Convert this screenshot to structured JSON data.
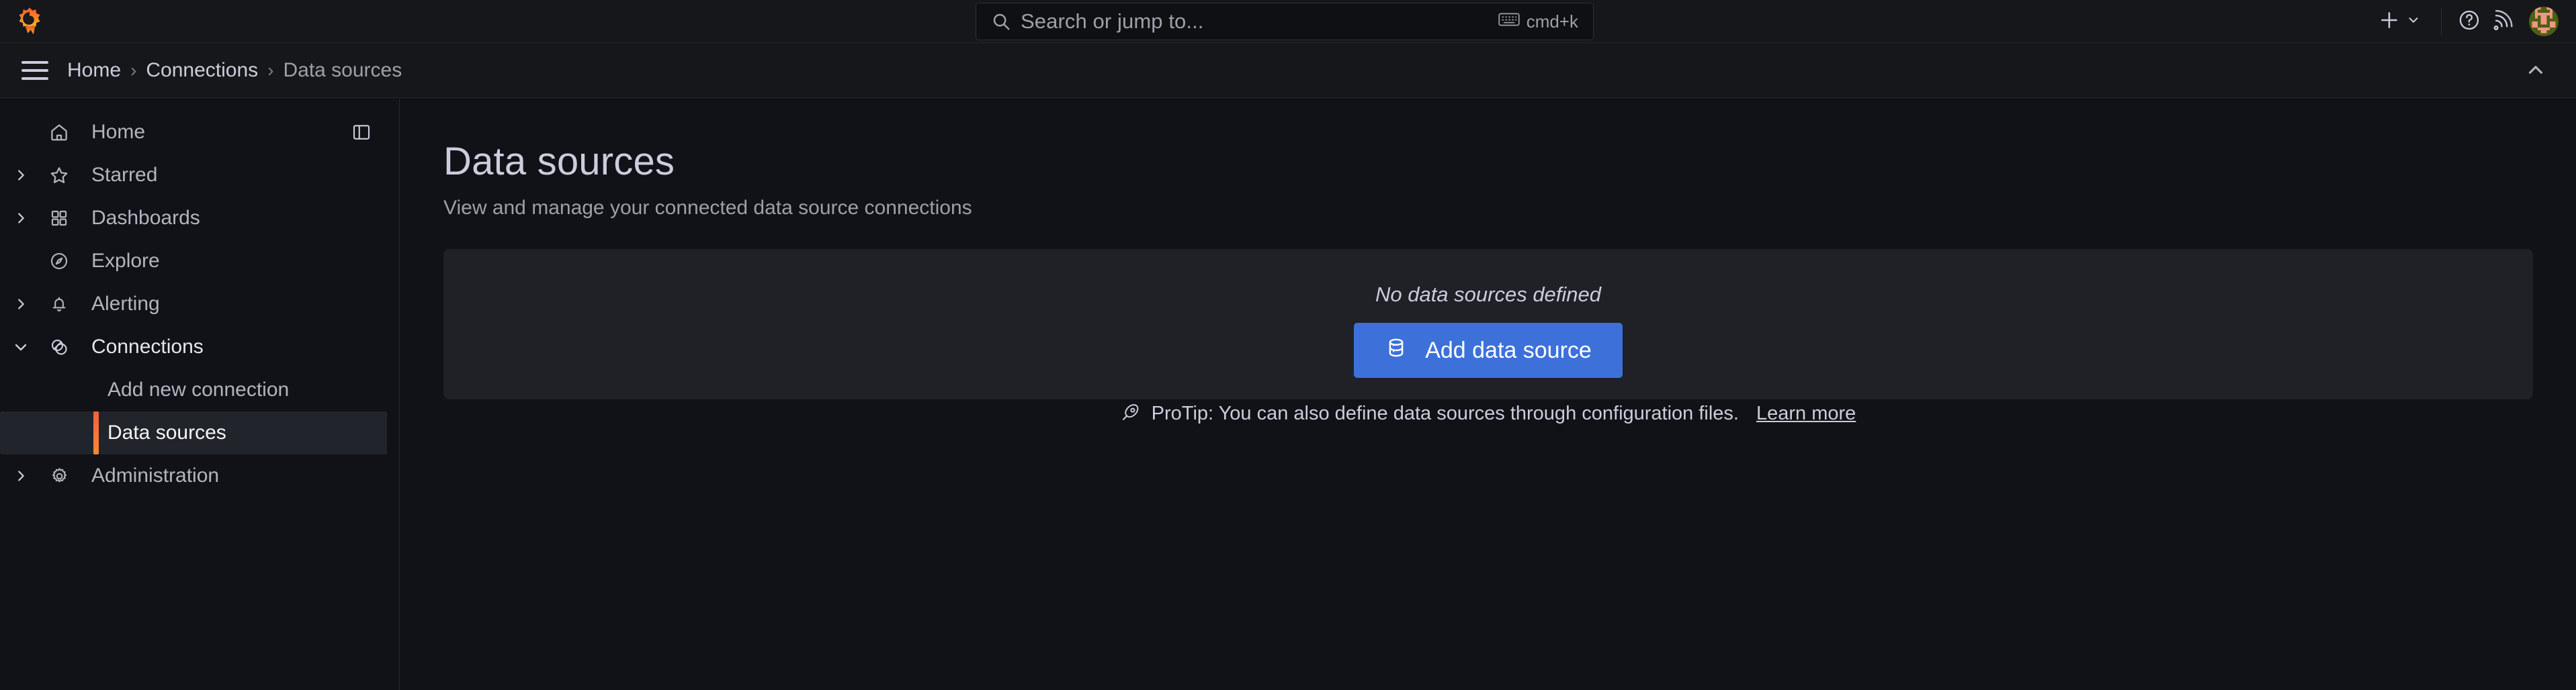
{
  "topbar": {
    "logo_icon": "grafana-logo-icon",
    "search": {
      "placeholder": "Search or jump to...",
      "value": "",
      "icon": "search-icon",
      "shortcut_icon": "keyboard-icon",
      "shortcut_label": "cmd+k"
    },
    "actions": {
      "plus_icon": "plus-icon",
      "plus_chevron_icon": "chevron-down-icon",
      "help_icon": "question-circle-icon",
      "news_icon": "rss-icon",
      "avatar_icon": "user-avatar"
    }
  },
  "breadcrumb": {
    "menu_icon": "hamburger-menu-icon",
    "collapse_icon": "chevron-up-icon",
    "separator": "›",
    "items": [
      {
        "label": "Home",
        "current": false
      },
      {
        "label": "Connections",
        "current": false
      },
      {
        "label": "Data sources",
        "current": true
      }
    ]
  },
  "sidebar": {
    "dock_icon": "dock-menu-icon",
    "items": [
      {
        "label": "Home",
        "icon": "home-icon",
        "chevron": "none",
        "expanded": false,
        "active": false
      },
      {
        "label": "Starred",
        "icon": "star-icon",
        "chevron": "right",
        "expanded": false,
        "active": false
      },
      {
        "label": "Dashboards",
        "icon": "apps-grid-icon",
        "chevron": "right",
        "expanded": false,
        "active": false
      },
      {
        "label": "Explore",
        "icon": "compass-icon",
        "chevron": "none",
        "expanded": false,
        "active": false
      },
      {
        "label": "Alerting",
        "icon": "bell-icon",
        "chevron": "right",
        "expanded": false,
        "active": false
      },
      {
        "label": "Connections",
        "icon": "connections-icon",
        "chevron": "down",
        "expanded": true,
        "active": true
      },
      {
        "label": "Administration",
        "icon": "gear-icon",
        "chevron": "right",
        "expanded": false,
        "active": false
      }
    ],
    "connections_children": [
      {
        "label": "Add new connection",
        "selected": false
      },
      {
        "label": "Data sources",
        "selected": true
      }
    ]
  },
  "main": {
    "title": "Data sources",
    "subtitle": "View and manage your connected data source connections",
    "empty_state": {
      "message": "No data sources defined",
      "add_button_label": "Add data source",
      "add_button_icon": "database-icon",
      "protip_icon": "rocket-icon",
      "protip_text": "ProTip: You can also define data sources through configuration files.",
      "protip_link_label": "Learn more"
    }
  },
  "colors": {
    "page_background": "#111217",
    "chrome_background": "#16171b",
    "panel_background": "#1f2127",
    "primary_button": "#3d71d9",
    "accent_orange": "#f55f3e",
    "text_primary": "#ccccdc",
    "text_secondary": "#9da0a8",
    "border": "#25272e"
  }
}
